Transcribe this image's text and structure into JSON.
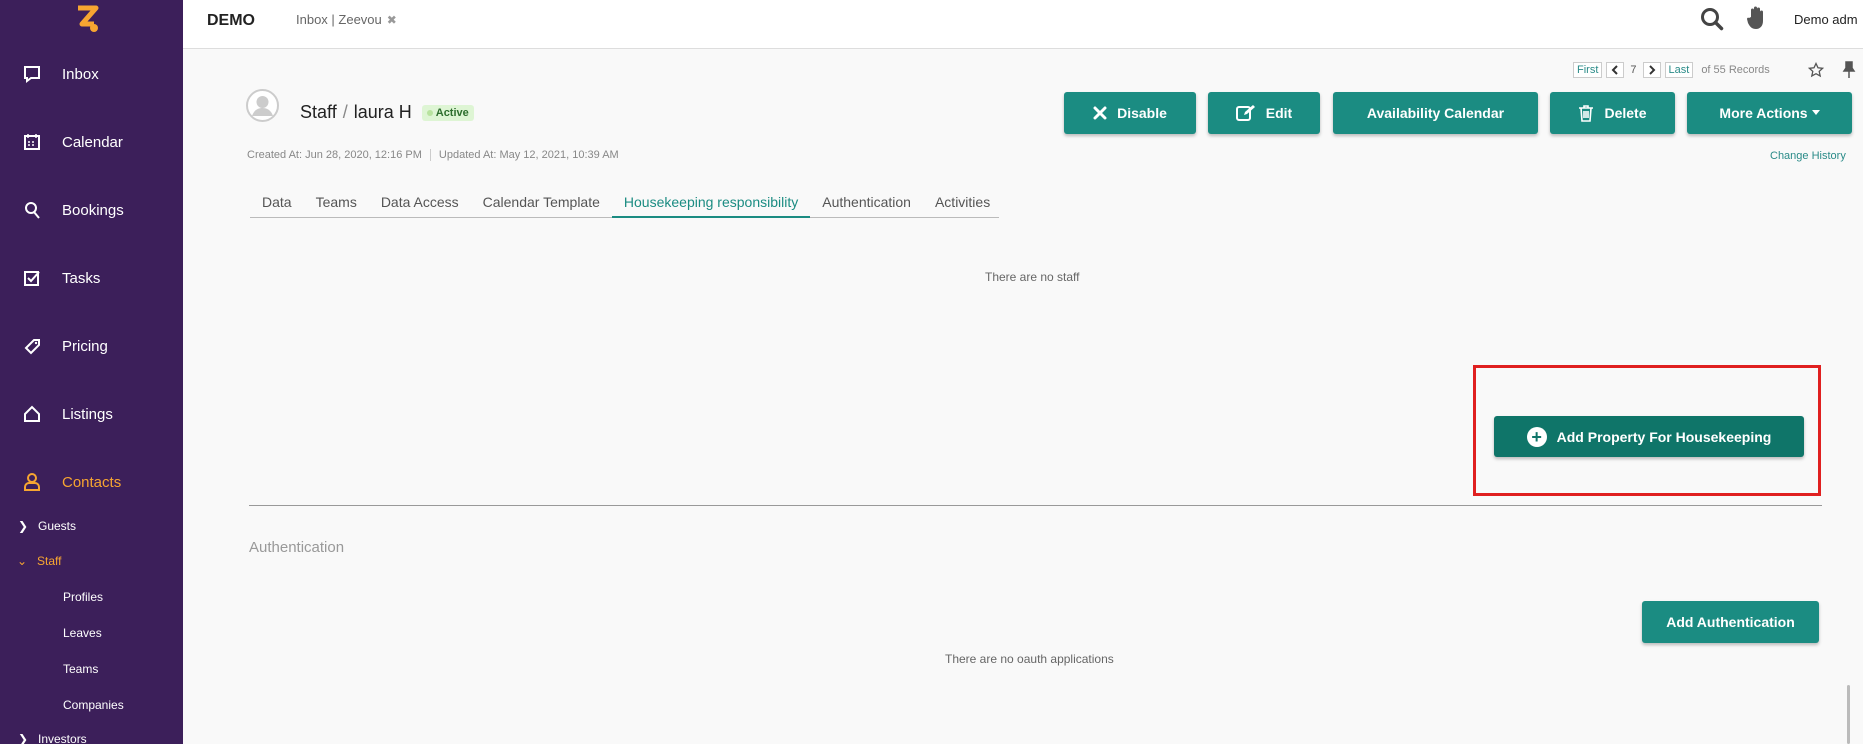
{
  "sidebar": {
    "nav": [
      {
        "label": "Inbox",
        "icon": "inbox-icon"
      },
      {
        "label": "Calendar",
        "icon": "calendar-icon"
      },
      {
        "label": "Bookings",
        "icon": "bookings-icon"
      },
      {
        "label": "Tasks",
        "icon": "tasks-icon"
      },
      {
        "label": "Pricing",
        "icon": "tag-icon"
      },
      {
        "label": "Listings",
        "icon": "home-icon"
      },
      {
        "label": "Contacts",
        "icon": "user-icon"
      }
    ],
    "contacts_sub": {
      "guests": "Guests",
      "staff": "Staff",
      "profiles": "Profiles",
      "leaves": "Leaves",
      "teams": "Teams",
      "companies": "Companies",
      "investors": "Investors"
    }
  },
  "header": {
    "demo": "DEMO",
    "tab_label": "Inbox | Zeevou",
    "user": "Demo adm"
  },
  "pager": {
    "first": "First",
    "current": "7",
    "last": "Last",
    "total": "of 55 Records"
  },
  "record": {
    "module": "Staff",
    "separator": "/",
    "name": "laura H",
    "status": "Active",
    "created": "Created At: Jun 28, 2020, 12:16 PM",
    "updated": "Updated At: May 12, 2021, 10:39 AM",
    "change_history": "Change History"
  },
  "actions": {
    "disable": "Disable",
    "edit": "Edit",
    "availability": "Availability Calendar",
    "delete": "Delete",
    "more": "More Actions"
  },
  "tabs": [
    "Data",
    "Teams",
    "Data Access",
    "Calendar Template",
    "Housekeeping responsibility",
    "Authentication",
    "Activities"
  ],
  "housekeeping": {
    "empty": "There are no staff",
    "add_button": "Add Property For Housekeeping"
  },
  "authentication": {
    "heading": "Authentication",
    "add_button": "Add Authentication",
    "empty": "There are no oauth applications"
  },
  "colors": {
    "sidebar_bg": "#3c1f5a",
    "accent": "#1b8c82",
    "active_nav": "#f7a531",
    "highlight_box": "#e02020"
  }
}
